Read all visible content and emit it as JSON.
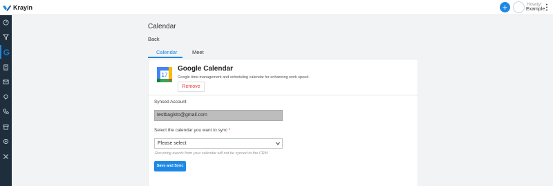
{
  "app": {
    "name": "Krayin",
    "brand_color": "#1e88e5",
    "sidebar_color": "#1f2e3c"
  },
  "header": {
    "add_icon": "plus-icon",
    "greeting": "Howdy!",
    "username": "Example",
    "menu_icon": "more-vertical-icon"
  },
  "sidebar": {
    "items": [
      {
        "icon": "dashboard-icon",
        "active": false
      },
      {
        "icon": "filter-icon",
        "active": false
      },
      {
        "icon": "google-icon",
        "active": true
      },
      {
        "icon": "quotes-icon",
        "active": false
      },
      {
        "icon": "mail-icon",
        "active": false
      },
      {
        "icon": "activity-icon",
        "active": false
      },
      {
        "icon": "phone-icon",
        "active": false
      },
      {
        "icon": "products-icon",
        "active": false
      },
      {
        "icon": "settings-icon",
        "active": false
      },
      {
        "icon": "tools-icon",
        "active": false
      }
    ]
  },
  "page": {
    "title": "Calendar",
    "back": "Back",
    "tabs": [
      {
        "label": "Calendar",
        "active": true
      },
      {
        "label": "Meet",
        "active": false
      }
    ]
  },
  "integration": {
    "title": "Google Calendar",
    "description": "Google time-management and scheduling calendar for enhancing work speed.",
    "remove_label": "Remove",
    "icon": "google-calendar-icon",
    "icon_number": "17"
  },
  "form": {
    "synced_label": "Synced Account",
    "synced_value": "testbagisto@gmail.com",
    "select_label": "Select the calendar you want to sync",
    "required_mark": "*",
    "select_value": "Please select",
    "hint": "Recurring events from your calendar will not be synced to the CRM",
    "save_label": "Save and Sync"
  }
}
